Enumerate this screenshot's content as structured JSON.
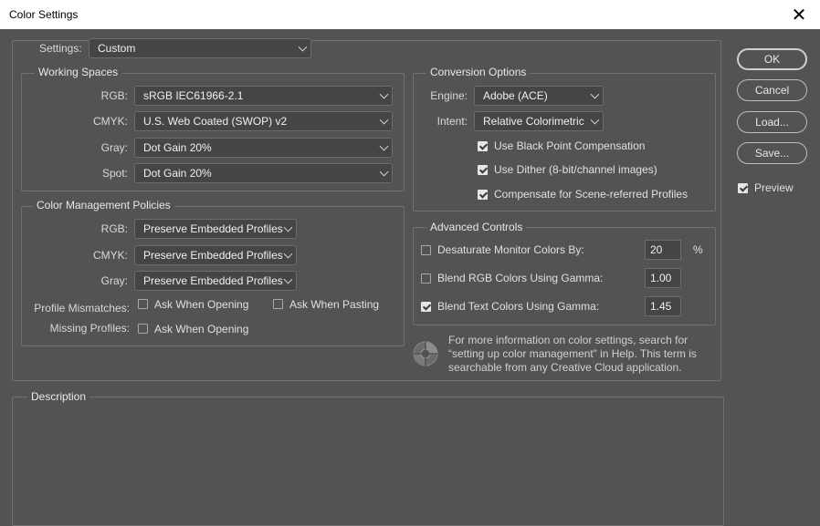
{
  "window": {
    "title": "Color Settings",
    "close_glyph": "✕"
  },
  "settings": {
    "label": "Settings:",
    "value": "Custom"
  },
  "working_spaces": {
    "title": "Working Spaces",
    "rgb": {
      "label": "RGB:",
      "value": "sRGB IEC61966-2.1"
    },
    "cmyk": {
      "label": "CMYK:",
      "value": "U.S. Web Coated (SWOP) v2"
    },
    "gray": {
      "label": "Gray:",
      "value": "Dot Gain 20%"
    },
    "spot": {
      "label": "Spot:",
      "value": "Dot Gain 20%"
    }
  },
  "policies": {
    "title": "Color Management Policies",
    "rgb": {
      "label": "RGB:",
      "value": "Preserve Embedded Profiles"
    },
    "cmyk": {
      "label": "CMYK:",
      "value": "Preserve Embedded Profiles"
    },
    "gray": {
      "label": "Gray:",
      "value": "Preserve Embedded Profiles"
    },
    "mismatches": {
      "label": "Profile Mismatches:",
      "opening": "Ask When Opening",
      "pasting": "Ask When Pasting",
      "opening_checked": false,
      "pasting_checked": false
    },
    "missing": {
      "label": "Missing Profiles:",
      "opening": "Ask When Opening",
      "opening_checked": false
    }
  },
  "conversion": {
    "title": "Conversion Options",
    "engine": {
      "label": "Engine:",
      "value": "Adobe (ACE)"
    },
    "intent": {
      "label": "Intent:",
      "value": "Relative Colorimetric"
    },
    "black_point": {
      "label": "Use Black Point Compensation",
      "checked": true
    },
    "dither": {
      "label": "Use Dither (8-bit/channel images)",
      "checked": true
    },
    "scene": {
      "label": "Compensate for Scene-referred Profiles",
      "checked": true
    }
  },
  "advanced": {
    "title": "Advanced Controls",
    "desaturate": {
      "label": "Desaturate Monitor Colors By:",
      "value": "20",
      "unit": "%",
      "checked": false
    },
    "blend_rgb": {
      "label": "Blend RGB Colors Using Gamma:",
      "value": "1.00",
      "checked": false
    },
    "blend_text": {
      "label": "Blend Text Colors Using Gamma:",
      "value": "1.45",
      "checked": true
    }
  },
  "info": {
    "icon": "color-wheel-icon",
    "text": "For more information on color settings, search for “setting up color management” in Help. This term is searchable from any Creative Cloud application."
  },
  "description": {
    "title": "Description"
  },
  "buttons": {
    "ok": "OK",
    "cancel": "Cancel",
    "load": "Load...",
    "save": "Save..."
  },
  "preview": {
    "label": "Preview",
    "checked": true
  }
}
